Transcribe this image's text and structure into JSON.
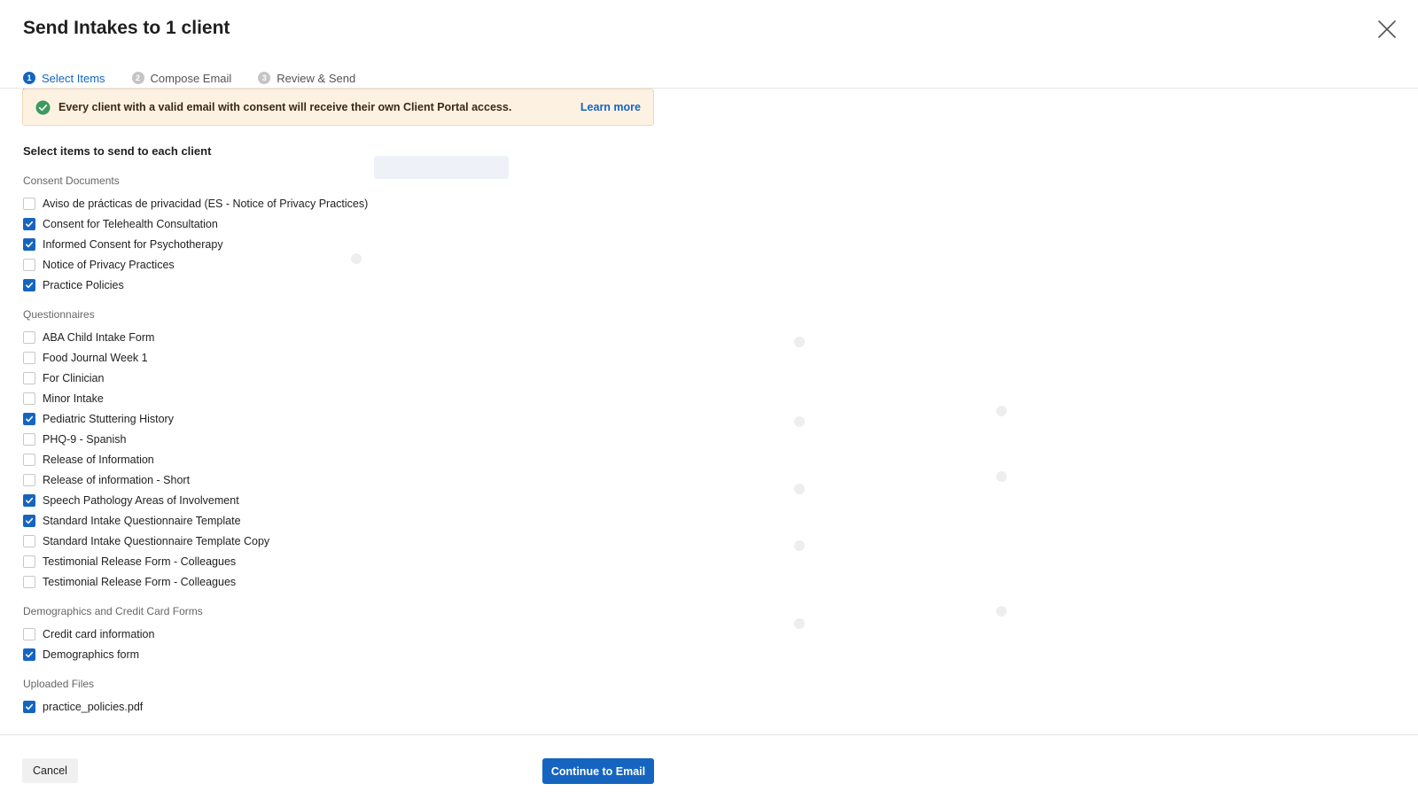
{
  "modal": {
    "title": "Send Intakes to 1 client",
    "steps": [
      {
        "number": "1",
        "label": "Select Items"
      },
      {
        "number": "2",
        "label": "Compose Email"
      },
      {
        "number": "3",
        "label": "Review & Send"
      }
    ],
    "banner": {
      "text": "Every client with a valid email with consent will receive their own Client Portal access.",
      "link": "Learn more"
    },
    "section_heading": "Select items to send to each client",
    "groups": [
      {
        "label": "Consent Documents",
        "items": [
          {
            "label": "Aviso de prácticas de privacidad (ES - Notice of Privacy Practices)",
            "checked": false
          },
          {
            "label": "Consent for Telehealth Consultation",
            "checked": true
          },
          {
            "label": "Informed Consent for Psychotherapy",
            "checked": true
          },
          {
            "label": "Notice of Privacy Practices",
            "checked": false
          },
          {
            "label": "Practice Policies",
            "checked": true
          }
        ]
      },
      {
        "label": "Questionnaires",
        "items": [
          {
            "label": "ABA Child Intake Form",
            "checked": false
          },
          {
            "label": "Food Journal Week 1",
            "checked": false
          },
          {
            "label": "For Clinician",
            "checked": false
          },
          {
            "label": "Minor Intake",
            "checked": false
          },
          {
            "label": "Pediatric Stuttering History",
            "checked": true
          },
          {
            "label": "PHQ-9 - Spanish",
            "checked": false
          },
          {
            "label": "Release of Information",
            "checked": false
          },
          {
            "label": "Release of information - Short",
            "checked": false
          },
          {
            "label": "Speech Pathology Areas of Involvement",
            "checked": true
          },
          {
            "label": "Standard Intake Questionnaire Template",
            "checked": true
          },
          {
            "label": "Standard Intake Questionnaire Template Copy",
            "checked": false
          },
          {
            "label": "Testimonial Release Form - Colleagues",
            "checked": false
          },
          {
            "label": "Testimonial Release Form - Colleagues",
            "checked": false
          }
        ]
      },
      {
        "label": "Demographics and Credit Card Forms",
        "items": [
          {
            "label": "Credit card information",
            "checked": false
          },
          {
            "label": "Demographics form",
            "checked": true
          }
        ]
      },
      {
        "label": "Uploaded Files",
        "items": [
          {
            "label": "practice_policies.pdf",
            "checked": true
          }
        ]
      }
    ],
    "footer": {
      "cancel_label": "Cancel",
      "continue_label": "Continue to Email"
    }
  },
  "icons": {
    "close": "close-icon",
    "banner": "check-circle-icon",
    "checkbox": "checkmark-icon"
  },
  "colors": {
    "accent": "#1565c0",
    "banner_bg": "#fdf1e2",
    "success": "#3c9a5f"
  }
}
